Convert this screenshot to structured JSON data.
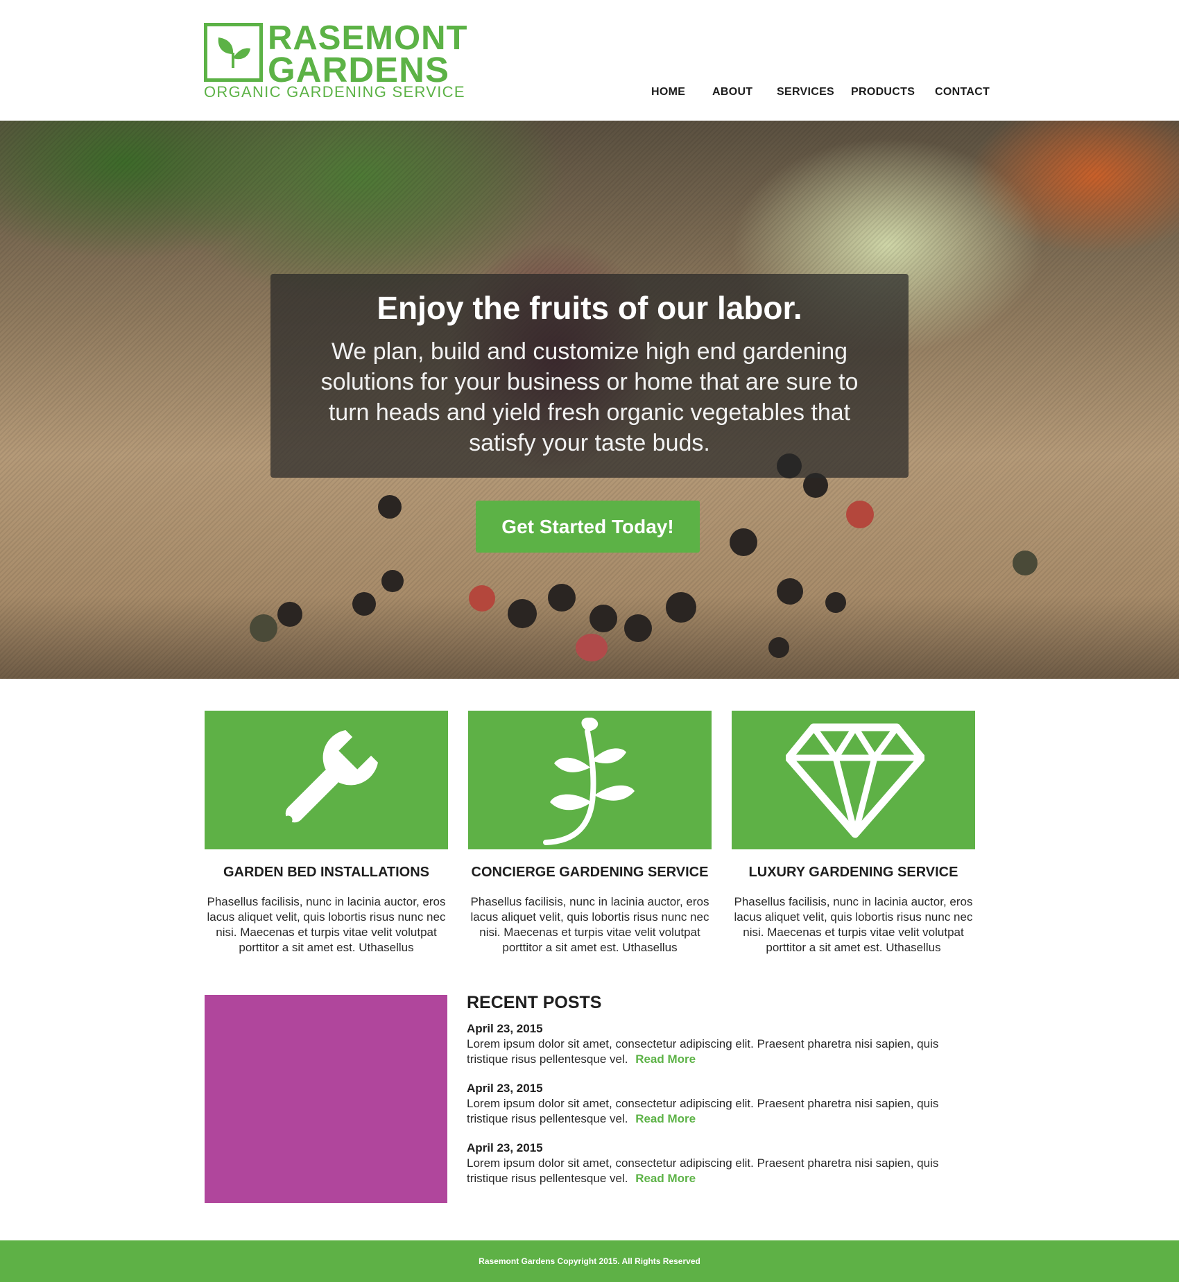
{
  "brand": {
    "line1": "RASEMONT",
    "line2": "GARDENS",
    "tagline": "ORGANIC GARDENING SERVICE",
    "logo_icon": "sprout-icon",
    "color": "#5cb246"
  },
  "nav": {
    "items": [
      {
        "label": "HOME"
      },
      {
        "label": "ABOUT"
      },
      {
        "label": "SERVICES"
      },
      {
        "label": "PRODUCTS"
      },
      {
        "label": "CONTACT"
      }
    ]
  },
  "hero": {
    "title": "Enjoy the fruits of our labor.",
    "subtitle": "We plan, build and customize  high end gardening solutions for your business or home that are sure to turn heads and yield fresh organic vegetables that satisfy your taste buds.",
    "cta_label": "Get Started Today!"
  },
  "services": [
    {
      "icon": "wrench-icon",
      "title": "GARDEN BED INSTALLATIONS",
      "text": "Phasellus facilisis, nunc in lacinia auctor, eros lacus aliquet velit, quis lobortis risus nunc nec nisi. Maecenas et turpis vitae velit volutpat porttitor a sit amet est. Uthasellus"
    },
    {
      "icon": "leaf-branch-icon",
      "title": "CONCIERGE GARDENING SERVICE",
      "text": "Phasellus facilisis, nunc in lacinia auctor, eros lacus aliquet velit, quis lobortis risus nunc nec nisi. Maecenas et turpis vitae velit volutpat porttitor a sit amet est. Uthasellus"
    },
    {
      "icon": "diamond-icon",
      "title": "LUXURY GARDENING SERVICE",
      "text": "Phasellus facilisis, nunc in lacinia auctor, eros lacus aliquet velit, quis lobortis risus nunc nec nisi. Maecenas et turpis vitae velit volutpat porttitor a sit amet est. Uthasellus"
    }
  ],
  "recent_posts": {
    "heading": "RECENT POSTS",
    "posts": [
      {
        "date": "April 23, 2015",
        "text": "Lorem ipsum dolor sit amet, consectetur adipiscing elit. Praesent pharetra nisi sapien, quis tristique risus pellentesque vel.",
        "more": "Read More"
      },
      {
        "date": "April 23, 2015",
        "text": "Lorem ipsum dolor sit amet, consectetur adipiscing elit. Praesent pharetra nisi sapien, quis tristique risus pellentesque vel.",
        "more": "Read More"
      },
      {
        "date": "April 23, 2015",
        "text": "Lorem ipsum dolor sit amet, consectetur adipiscing elit. Praesent pharetra nisi sapien, quis tristique risus pellentesque vel.",
        "more": "Read More"
      }
    ]
  },
  "footer": {
    "copyright": "Rasemont Gardens Copyright 2015. All Rights Reserved"
  },
  "colors": {
    "accent": "#5cb246",
    "post_image": "#b0469c"
  }
}
